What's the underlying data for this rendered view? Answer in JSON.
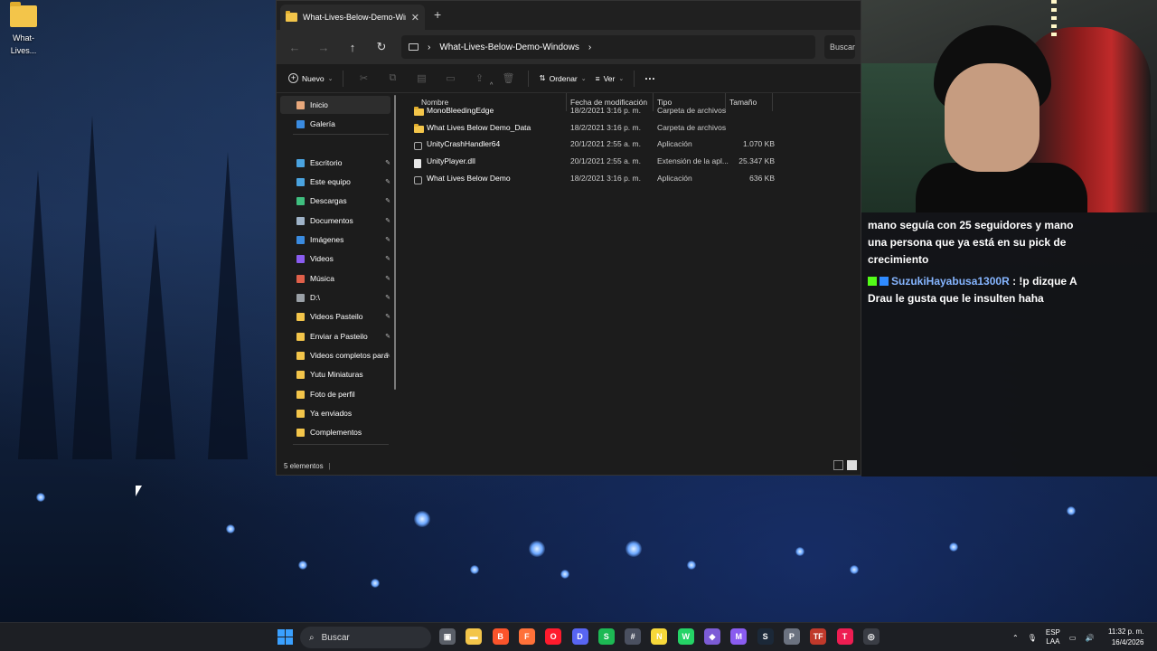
{
  "desktop": {
    "icon_label": "What-Lives..."
  },
  "explorer": {
    "tab_title": "What-Lives-Below-Demo-Win",
    "tab_close": "✕",
    "new_tab": "+",
    "address_path": "What-Lives-Below-Demo-Windows",
    "address_chevron": "›",
    "search_placeholder": "Buscar en",
    "nav": {
      "back": "←",
      "forward": "→",
      "up": "↑",
      "refresh": "↻"
    },
    "cmdbar": {
      "new_label": "Nuevo",
      "sort_label": "Ordenar",
      "view_label": "Ver",
      "more_label": "···"
    },
    "sidebar": {
      "items": [
        {
          "label": "Inicio",
          "color": "#e8a87c"
        },
        {
          "label": "Galería",
          "color": "#3a8be0"
        },
        {
          "label": "Escritorio",
          "color": "#4aa3df"
        },
        {
          "label": "Este equipo",
          "color": "#4aa3df"
        },
        {
          "label": "Descargas",
          "color": "#3fbf7f"
        },
        {
          "label": "Documentos",
          "color": "#9fb3c8"
        },
        {
          "label": "Imágenes",
          "color": "#3a8be0"
        },
        {
          "label": "Videos",
          "color": "#8a5cf0"
        },
        {
          "label": "Música",
          "color": "#e0604a"
        },
        {
          "label": "D:\\",
          "color": "#9aa0a6"
        },
        {
          "label": "Videos Pasteilo",
          "color": "#f3c54a"
        },
        {
          "label": "Enviar a Pasteilo",
          "color": "#f3c54a"
        },
        {
          "label": "Videos completos para",
          "color": "#f3c54a"
        },
        {
          "label": "Yutu Miniaturas",
          "color": "#f3c54a"
        },
        {
          "label": "Foto de perfil",
          "color": "#f3c54a"
        },
        {
          "label": "Ya enviados",
          "color": "#f3c54a"
        },
        {
          "label": "Complementos",
          "color": "#f3c54a"
        }
      ],
      "pin_glyph": "📌"
    },
    "columns": [
      "Nombre",
      "Fecha de modificación",
      "Tipo",
      "Tamaño"
    ],
    "sort_caret": "^",
    "files": [
      {
        "name": "MonoBleedingEdge",
        "date": "18/2/2021 3:16 p. m.",
        "type": "Carpeta de archivos",
        "size": "",
        "icon": "folder-icon"
      },
      {
        "name": "What Lives Below Demo_Data",
        "date": "18/2/2021 3:16 p. m.",
        "type": "Carpeta de archivos",
        "size": "",
        "icon": "folder-icon"
      },
      {
        "name": "UnityCrashHandler64",
        "date": "20/1/2021 2:55 a. m.",
        "type": "Aplicación",
        "size": "1.070 KB",
        "icon": "app-icon"
      },
      {
        "name": "UnityPlayer.dll",
        "date": "20/1/2021 2:55 a. m.",
        "type": "Extensión de la apl...",
        "size": "25.347 KB",
        "icon": "dll-icon"
      },
      {
        "name": "What Lives Below Demo",
        "date": "18/2/2021 3:16 p. m.",
        "type": "Aplicación",
        "size": "636 KB",
        "icon": "app-icon"
      }
    ],
    "status": "5 elementos"
  },
  "chat": {
    "line1": "mano seguía con 25 seguidores y mano una persona que ya está en su pick de crecimiento",
    "user": "SuzukiHayabusa1300R",
    "message": ": !p dizque A Drau le gusta que le insulten haha"
  },
  "taskbar": {
    "search_label": "Buscar",
    "lang_top": "ESP",
    "lang_bottom": "LAA",
    "time": "11:32 p. m.",
    "date": "16/4/2026",
    "apps": [
      {
        "name": "task-view-icon",
        "color": "#5a5f68",
        "glyph": "▣"
      },
      {
        "name": "file-explorer-icon",
        "color": "#f3c54a",
        "glyph": "▬"
      },
      {
        "name": "brave-icon",
        "color": "#fb542b",
        "glyph": "B"
      },
      {
        "name": "firefox-icon",
        "color": "#ff7139",
        "glyph": "F"
      },
      {
        "name": "opera-icon",
        "color": "#ff1b2d",
        "glyph": "O"
      },
      {
        "name": "discord-icon",
        "color": "#5865f2",
        "glyph": "D"
      },
      {
        "name": "spotify-icon",
        "color": "#1db954",
        "glyph": "S"
      },
      {
        "name": "calculator-icon",
        "color": "#4a5060",
        "glyph": "#"
      },
      {
        "name": "sticky-notes-icon",
        "color": "#f7d83a",
        "glyph": "N"
      },
      {
        "name": "whatsapp-icon",
        "color": "#25d366",
        "glyph": "W"
      },
      {
        "name": "obsidian-icon",
        "color": "#7c5cd6",
        "glyph": "◆"
      },
      {
        "name": "gmail-icon",
        "color": "#8a5cf0",
        "glyph": "M"
      },
      {
        "name": "steam-icon",
        "color": "#1b2838",
        "glyph": "S"
      },
      {
        "name": "printer-icon",
        "color": "#6b7280",
        "glyph": "P"
      },
      {
        "name": "tf-icon",
        "color": "#c0392b",
        "glyph": "TF"
      },
      {
        "name": "tiktok-icon",
        "color": "#ee1d52",
        "glyph": "T"
      },
      {
        "name": "obs-icon",
        "color": "#3a3d45",
        "glyph": "◎"
      }
    ]
  }
}
